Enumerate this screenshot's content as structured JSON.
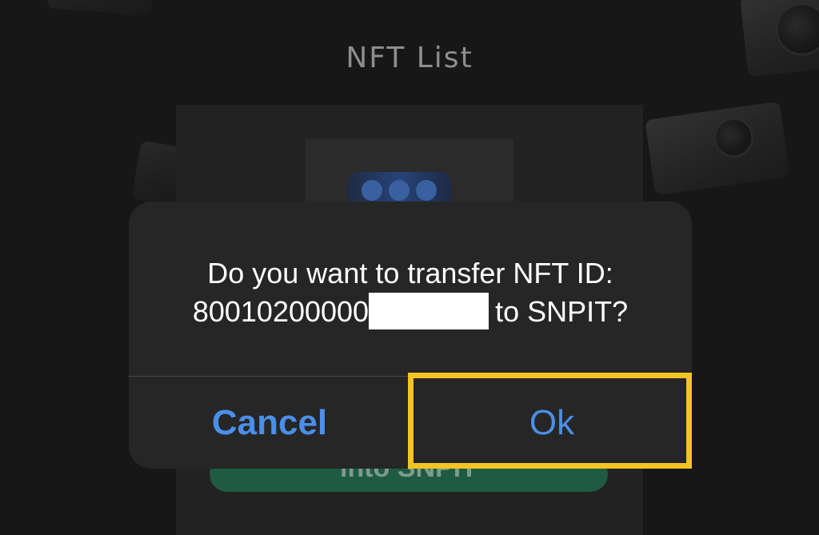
{
  "page": {
    "title": "NFT List"
  },
  "nft_card": {
    "action_button_label": "into SNPIT"
  },
  "dialog": {
    "message_line1": "Do you want to transfer NFT ID:",
    "nft_id_prefix": "80010200000",
    "message_suffix": "to SNPIT?",
    "cancel_label": "Cancel",
    "ok_label": "Ok"
  },
  "colors": {
    "button_text": "#4a8fe8",
    "highlight": "#f2c424",
    "dialog_background": "#262626"
  }
}
